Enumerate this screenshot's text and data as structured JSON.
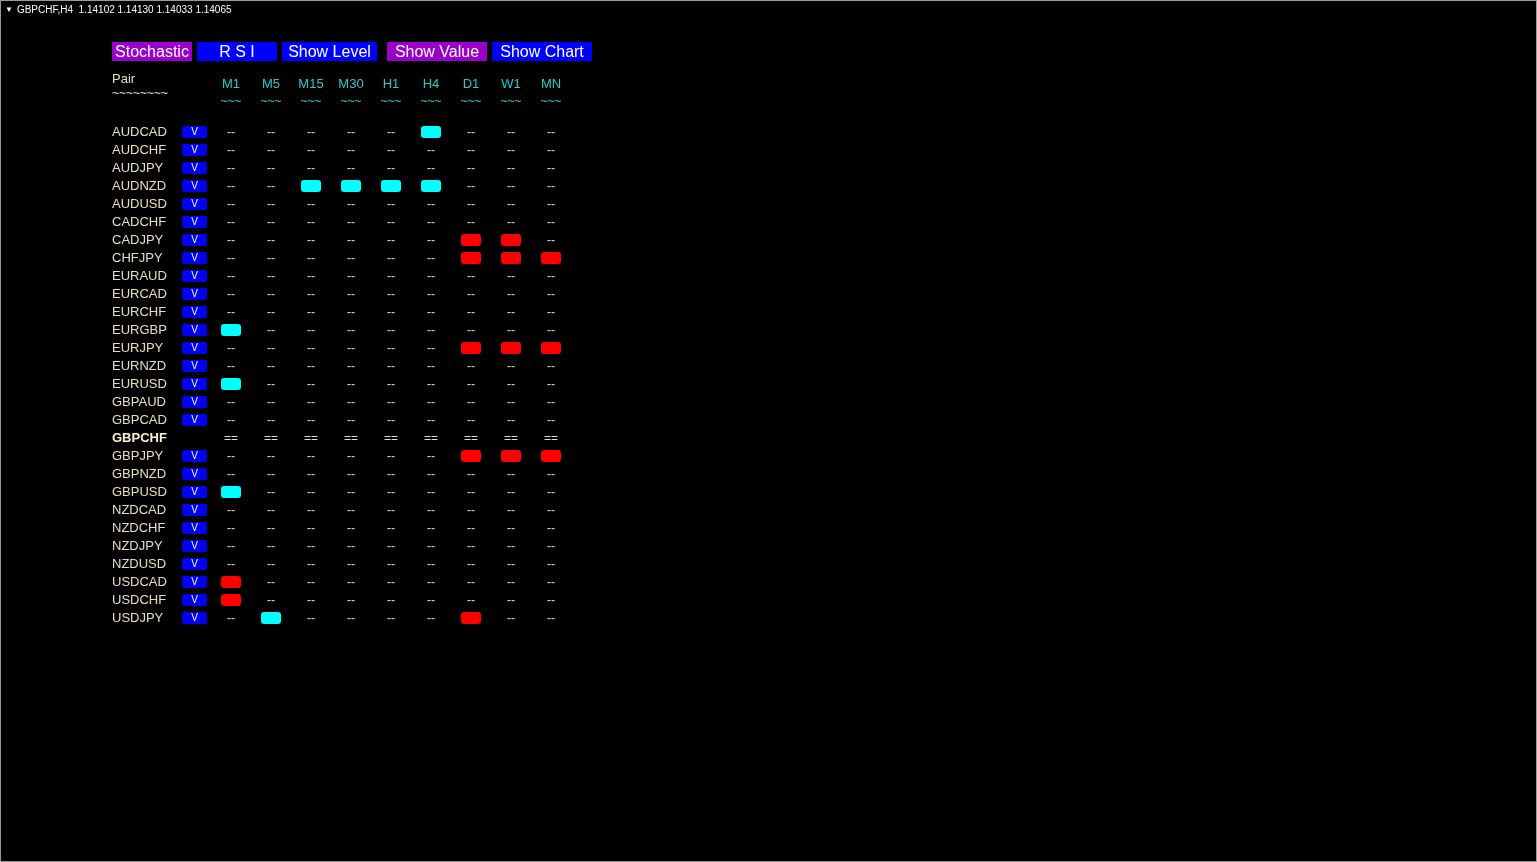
{
  "chart_title": {
    "arrow": "▼",
    "text": "GBPCHF,H4  1.14102 1.14130 1.14033 1.14065"
  },
  "buttons": [
    {
      "label": "Stochastic",
      "selected": true
    },
    {
      "label": "R S I",
      "selected": false
    },
    {
      "label": "Show Level",
      "selected": false
    },
    {
      "label": "Show Value",
      "selected": true
    },
    {
      "label": "Show Chart",
      "selected": false
    }
  ],
  "table": {
    "pair_header": {
      "label": "Pair",
      "underline": "~~~~~~~~"
    },
    "columns": [
      {
        "label": "M1",
        "underline": "~~~"
      },
      {
        "label": "M5",
        "underline": "~~~"
      },
      {
        "label": "M15",
        "underline": "~~~"
      },
      {
        "label": "M30",
        "underline": "~~~"
      },
      {
        "label": "H1",
        "underline": "~~~"
      },
      {
        "label": "H4",
        "underline": "~~~"
      },
      {
        "label": "D1",
        "underline": "~~~"
      },
      {
        "label": "W1",
        "underline": "~~~"
      },
      {
        "label": "MN",
        "underline": "~~~"
      }
    ],
    "rows": [
      {
        "pair": "AUDCAD",
        "current": false,
        "button": "V",
        "cells": [
          {
            "kind": "text",
            "text": "--"
          },
          {
            "kind": "text",
            "text": "--"
          },
          {
            "kind": "text",
            "text": "--"
          },
          {
            "kind": "text",
            "text": "--"
          },
          {
            "kind": "text",
            "text": "--"
          },
          {
            "kind": "signal",
            "color": "#00ffff"
          },
          {
            "kind": "text",
            "text": "--"
          },
          {
            "kind": "text",
            "text": "--"
          },
          {
            "kind": "text",
            "text": "--"
          }
        ]
      },
      {
        "pair": "AUDCHF",
        "current": false,
        "button": "V",
        "cells": [
          {
            "kind": "text",
            "text": "--"
          },
          {
            "kind": "text",
            "text": "--"
          },
          {
            "kind": "text",
            "text": "--"
          },
          {
            "kind": "text",
            "text": "--"
          },
          {
            "kind": "text",
            "text": "--"
          },
          {
            "kind": "text",
            "text": "--"
          },
          {
            "kind": "text",
            "text": "--"
          },
          {
            "kind": "text",
            "text": "--"
          },
          {
            "kind": "text",
            "text": "--"
          }
        ]
      },
      {
        "pair": "AUDJPY",
        "current": false,
        "button": "V",
        "cells": [
          {
            "kind": "text",
            "text": "--"
          },
          {
            "kind": "text",
            "text": "--"
          },
          {
            "kind": "text",
            "text": "--"
          },
          {
            "kind": "text",
            "text": "--"
          },
          {
            "kind": "text",
            "text": "--"
          },
          {
            "kind": "text",
            "text": "--"
          },
          {
            "kind": "text",
            "text": "--"
          },
          {
            "kind": "text",
            "text": "--"
          },
          {
            "kind": "text",
            "text": "--"
          }
        ]
      },
      {
        "pair": "AUDNZD",
        "current": false,
        "button": "V",
        "cells": [
          {
            "kind": "text",
            "text": "--"
          },
          {
            "kind": "text",
            "text": "--"
          },
          {
            "kind": "signal",
            "color": "#00ffff"
          },
          {
            "kind": "signal",
            "color": "#00ffff"
          },
          {
            "kind": "signal",
            "color": "#00ffff"
          },
          {
            "kind": "signal",
            "color": "#00ffff"
          },
          {
            "kind": "text",
            "text": "--"
          },
          {
            "kind": "text",
            "text": "--"
          },
          {
            "kind": "text",
            "text": "--"
          }
        ]
      },
      {
        "pair": "AUDUSD",
        "current": false,
        "button": "V",
        "cells": [
          {
            "kind": "text",
            "text": "--"
          },
          {
            "kind": "text",
            "text": "--"
          },
          {
            "kind": "text",
            "text": "--"
          },
          {
            "kind": "text",
            "text": "--"
          },
          {
            "kind": "text",
            "text": "--"
          },
          {
            "kind": "text",
            "text": "--"
          },
          {
            "kind": "text",
            "text": "--"
          },
          {
            "kind": "text",
            "text": "--"
          },
          {
            "kind": "text",
            "text": "--"
          }
        ]
      },
      {
        "pair": "CADCHF",
        "current": false,
        "button": "V",
        "cells": [
          {
            "kind": "text",
            "text": "--"
          },
          {
            "kind": "text",
            "text": "--"
          },
          {
            "kind": "text",
            "text": "--"
          },
          {
            "kind": "text",
            "text": "--"
          },
          {
            "kind": "text",
            "text": "--"
          },
          {
            "kind": "text",
            "text": "--"
          },
          {
            "kind": "text",
            "text": "--"
          },
          {
            "kind": "text",
            "text": "--"
          },
          {
            "kind": "text",
            "text": "--"
          }
        ]
      },
      {
        "pair": "CADJPY",
        "current": false,
        "button": "V",
        "cells": [
          {
            "kind": "text",
            "text": "--"
          },
          {
            "kind": "text",
            "text": "--"
          },
          {
            "kind": "text",
            "text": "--"
          },
          {
            "kind": "text",
            "text": "--"
          },
          {
            "kind": "text",
            "text": "--"
          },
          {
            "kind": "text",
            "text": "--"
          },
          {
            "kind": "signal",
            "color": "#ff0000"
          },
          {
            "kind": "signal",
            "color": "#ff0000"
          },
          {
            "kind": "text",
            "text": "--"
          }
        ]
      },
      {
        "pair": "CHFJPY",
        "current": false,
        "button": "V",
        "cells": [
          {
            "kind": "text",
            "text": "--"
          },
          {
            "kind": "text",
            "text": "--"
          },
          {
            "kind": "text",
            "text": "--"
          },
          {
            "kind": "text",
            "text": "--"
          },
          {
            "kind": "text",
            "text": "--"
          },
          {
            "kind": "text",
            "text": "--"
          },
          {
            "kind": "signal",
            "color": "#ff0000"
          },
          {
            "kind": "signal",
            "color": "#ff0000"
          },
          {
            "kind": "signal",
            "color": "#ff0000"
          }
        ]
      },
      {
        "pair": "EURAUD",
        "current": false,
        "button": "V",
        "cells": [
          {
            "kind": "text",
            "text": "--"
          },
          {
            "kind": "text",
            "text": "--"
          },
          {
            "kind": "text",
            "text": "--"
          },
          {
            "kind": "text",
            "text": "--"
          },
          {
            "kind": "text",
            "text": "--"
          },
          {
            "kind": "text",
            "text": "--"
          },
          {
            "kind": "text",
            "text": "--"
          },
          {
            "kind": "text",
            "text": "--"
          },
          {
            "kind": "text",
            "text": "--"
          }
        ]
      },
      {
        "pair": "EURCAD",
        "current": false,
        "button": "V",
        "cells": [
          {
            "kind": "text",
            "text": "--"
          },
          {
            "kind": "text",
            "text": "--"
          },
          {
            "kind": "text",
            "text": "--"
          },
          {
            "kind": "text",
            "text": "--"
          },
          {
            "kind": "text",
            "text": "--"
          },
          {
            "kind": "text",
            "text": "--"
          },
          {
            "kind": "text",
            "text": "--"
          },
          {
            "kind": "text",
            "text": "--"
          },
          {
            "kind": "text",
            "text": "--"
          }
        ]
      },
      {
        "pair": "EURCHF",
        "current": false,
        "button": "V",
        "cells": [
          {
            "kind": "text",
            "text": "--"
          },
          {
            "kind": "text",
            "text": "--"
          },
          {
            "kind": "text",
            "text": "--"
          },
          {
            "kind": "text",
            "text": "--"
          },
          {
            "kind": "text",
            "text": "--"
          },
          {
            "kind": "text",
            "text": "--"
          },
          {
            "kind": "text",
            "text": "--"
          },
          {
            "kind": "text",
            "text": "--"
          },
          {
            "kind": "text",
            "text": "--"
          }
        ]
      },
      {
        "pair": "EURGBP",
        "current": false,
        "button": "V",
        "cells": [
          {
            "kind": "signal",
            "color": "#00ffff"
          },
          {
            "kind": "text",
            "text": "--"
          },
          {
            "kind": "text",
            "text": "--"
          },
          {
            "kind": "text",
            "text": "--"
          },
          {
            "kind": "text",
            "text": "--"
          },
          {
            "kind": "text",
            "text": "--"
          },
          {
            "kind": "text",
            "text": "--"
          },
          {
            "kind": "text",
            "text": "--"
          },
          {
            "kind": "text",
            "text": "--"
          }
        ]
      },
      {
        "pair": "EURJPY",
        "current": false,
        "button": "V",
        "cells": [
          {
            "kind": "text",
            "text": "--"
          },
          {
            "kind": "text",
            "text": "--"
          },
          {
            "kind": "text",
            "text": "--"
          },
          {
            "kind": "text",
            "text": "--"
          },
          {
            "kind": "text",
            "text": "--"
          },
          {
            "kind": "text",
            "text": "--"
          },
          {
            "kind": "signal",
            "color": "#ff0000"
          },
          {
            "kind": "signal",
            "color": "#ff0000"
          },
          {
            "kind": "signal",
            "color": "#ff0000"
          }
        ]
      },
      {
        "pair": "EURNZD",
        "current": false,
        "button": "V",
        "cells": [
          {
            "kind": "text",
            "text": "--"
          },
          {
            "kind": "text",
            "text": "--"
          },
          {
            "kind": "text",
            "text": "--"
          },
          {
            "kind": "text",
            "text": "--"
          },
          {
            "kind": "text",
            "text": "--"
          },
          {
            "kind": "text",
            "text": "--"
          },
          {
            "kind": "text",
            "text": "--"
          },
          {
            "kind": "text",
            "text": "--"
          },
          {
            "kind": "text",
            "text": "--"
          }
        ]
      },
      {
        "pair": "EURUSD",
        "current": false,
        "button": "V",
        "cells": [
          {
            "kind": "signal",
            "color": "#00ffff"
          },
          {
            "kind": "text",
            "text": "--"
          },
          {
            "kind": "text",
            "text": "--"
          },
          {
            "kind": "text",
            "text": "--"
          },
          {
            "kind": "text",
            "text": "--"
          },
          {
            "kind": "text",
            "text": "--"
          },
          {
            "kind": "text",
            "text": "--"
          },
          {
            "kind": "text",
            "text": "--"
          },
          {
            "kind": "text",
            "text": "--"
          }
        ]
      },
      {
        "pair": "GBPAUD",
        "current": false,
        "button": "V",
        "cells": [
          {
            "kind": "text",
            "text": "--"
          },
          {
            "kind": "text",
            "text": "--"
          },
          {
            "kind": "text",
            "text": "--"
          },
          {
            "kind": "text",
            "text": "--"
          },
          {
            "kind": "text",
            "text": "--"
          },
          {
            "kind": "text",
            "text": "--"
          },
          {
            "kind": "text",
            "text": "--"
          },
          {
            "kind": "text",
            "text": "--"
          },
          {
            "kind": "text",
            "text": "--"
          }
        ]
      },
      {
        "pair": "GBPCAD",
        "current": false,
        "button": "V",
        "cells": [
          {
            "kind": "text",
            "text": "--"
          },
          {
            "kind": "text",
            "text": "--"
          },
          {
            "kind": "text",
            "text": "--"
          },
          {
            "kind": "text",
            "text": "--"
          },
          {
            "kind": "text",
            "text": "--"
          },
          {
            "kind": "text",
            "text": "--"
          },
          {
            "kind": "text",
            "text": "--"
          },
          {
            "kind": "text",
            "text": "--"
          },
          {
            "kind": "text",
            "text": "--"
          }
        ]
      },
      {
        "pair": "GBPCHF",
        "current": true,
        "cells": [
          {
            "kind": "text",
            "text": "=="
          },
          {
            "kind": "text",
            "text": "=="
          },
          {
            "kind": "text",
            "text": "=="
          },
          {
            "kind": "text",
            "text": "=="
          },
          {
            "kind": "text",
            "text": "=="
          },
          {
            "kind": "text",
            "text": "=="
          },
          {
            "kind": "text",
            "text": "=="
          },
          {
            "kind": "text",
            "text": "=="
          },
          {
            "kind": "text",
            "text": "=="
          }
        ]
      },
      {
        "pair": "GBPJPY",
        "current": false,
        "button": "V",
        "cells": [
          {
            "kind": "text",
            "text": "--"
          },
          {
            "kind": "text",
            "text": "--"
          },
          {
            "kind": "text",
            "text": "--"
          },
          {
            "kind": "text",
            "text": "--"
          },
          {
            "kind": "text",
            "text": "--"
          },
          {
            "kind": "text",
            "text": "--"
          },
          {
            "kind": "signal",
            "color": "#ff0000"
          },
          {
            "kind": "signal",
            "color": "#ff0000"
          },
          {
            "kind": "signal",
            "color": "#ff0000"
          }
        ]
      },
      {
        "pair": "GBPNZD",
        "current": false,
        "button": "V",
        "cells": [
          {
            "kind": "text",
            "text": "--"
          },
          {
            "kind": "text",
            "text": "--"
          },
          {
            "kind": "text",
            "text": "--"
          },
          {
            "kind": "text",
            "text": "--"
          },
          {
            "kind": "text",
            "text": "--"
          },
          {
            "kind": "text",
            "text": "--"
          },
          {
            "kind": "text",
            "text": "--"
          },
          {
            "kind": "text",
            "text": "--"
          },
          {
            "kind": "text",
            "text": "--"
          }
        ]
      },
      {
        "pair": "GBPUSD",
        "current": false,
        "button": "V",
        "cells": [
          {
            "kind": "signal",
            "color": "#00ffff"
          },
          {
            "kind": "text",
            "text": "--"
          },
          {
            "kind": "text",
            "text": "--"
          },
          {
            "kind": "text",
            "text": "--"
          },
          {
            "kind": "text",
            "text": "--"
          },
          {
            "kind": "text",
            "text": "--"
          },
          {
            "kind": "text",
            "text": "--"
          },
          {
            "kind": "text",
            "text": "--"
          },
          {
            "kind": "text",
            "text": "--"
          }
        ]
      },
      {
        "pair": "NZDCAD",
        "current": false,
        "button": "V",
        "cells": [
          {
            "kind": "text",
            "text": "--"
          },
          {
            "kind": "text",
            "text": "--"
          },
          {
            "kind": "text",
            "text": "--"
          },
          {
            "kind": "text",
            "text": "--"
          },
          {
            "kind": "text",
            "text": "--"
          },
          {
            "kind": "text",
            "text": "--"
          },
          {
            "kind": "text",
            "text": "--"
          },
          {
            "kind": "text",
            "text": "--"
          },
          {
            "kind": "text",
            "text": "--"
          }
        ]
      },
      {
        "pair": "NZDCHF",
        "current": false,
        "button": "V",
        "cells": [
          {
            "kind": "text",
            "text": "--"
          },
          {
            "kind": "text",
            "text": "--"
          },
          {
            "kind": "text",
            "text": "--"
          },
          {
            "kind": "text",
            "text": "--"
          },
          {
            "kind": "text",
            "text": "--"
          },
          {
            "kind": "text",
            "text": "--"
          },
          {
            "kind": "text",
            "text": "--"
          },
          {
            "kind": "text",
            "text": "--"
          },
          {
            "kind": "text",
            "text": "--"
          }
        ]
      },
      {
        "pair": "NZDJPY",
        "current": false,
        "button": "V",
        "cells": [
          {
            "kind": "text",
            "text": "--"
          },
          {
            "kind": "text",
            "text": "--"
          },
          {
            "kind": "text",
            "text": "--"
          },
          {
            "kind": "text",
            "text": "--"
          },
          {
            "kind": "text",
            "text": "--"
          },
          {
            "kind": "text",
            "text": "--"
          },
          {
            "kind": "text",
            "text": "--"
          },
          {
            "kind": "text",
            "text": "--"
          },
          {
            "kind": "text",
            "text": "--"
          }
        ]
      },
      {
        "pair": "NZDUSD",
        "current": false,
        "button": "V",
        "cells": [
          {
            "kind": "text",
            "text": "--"
          },
          {
            "kind": "text",
            "text": "--"
          },
          {
            "kind": "text",
            "text": "--"
          },
          {
            "kind": "text",
            "text": "--"
          },
          {
            "kind": "text",
            "text": "--"
          },
          {
            "kind": "text",
            "text": "--"
          },
          {
            "kind": "text",
            "text": "--"
          },
          {
            "kind": "text",
            "text": "--"
          },
          {
            "kind": "text",
            "text": "--"
          }
        ]
      },
      {
        "pair": "USDCAD",
        "current": false,
        "button": "V",
        "cells": [
          {
            "kind": "signal",
            "color": "#ff0000"
          },
          {
            "kind": "text",
            "text": "--"
          },
          {
            "kind": "text",
            "text": "--"
          },
          {
            "kind": "text",
            "text": "--"
          },
          {
            "kind": "text",
            "text": "--"
          },
          {
            "kind": "text",
            "text": "--"
          },
          {
            "kind": "text",
            "text": "--"
          },
          {
            "kind": "text",
            "text": "--"
          },
          {
            "kind": "text",
            "text": "--"
          }
        ]
      },
      {
        "pair": "USDCHF",
        "current": false,
        "button": "V",
        "cells": [
          {
            "kind": "signal",
            "color": "#ff0000"
          },
          {
            "kind": "text",
            "text": "--"
          },
          {
            "kind": "text",
            "text": "--"
          },
          {
            "kind": "text",
            "text": "--"
          },
          {
            "kind": "text",
            "text": "--"
          },
          {
            "kind": "text",
            "text": "--"
          },
          {
            "kind": "text",
            "text": "--"
          },
          {
            "kind": "text",
            "text": "--"
          },
          {
            "kind": "text",
            "text": "--"
          }
        ]
      },
      {
        "pair": "USDJPY",
        "current": false,
        "button": "V",
        "cells": [
          {
            "kind": "text",
            "text": "--"
          },
          {
            "kind": "signal",
            "color": "#00ffff"
          },
          {
            "kind": "text",
            "text": "--"
          },
          {
            "kind": "text",
            "text": "--"
          },
          {
            "kind": "text",
            "text": "--"
          },
          {
            "kind": "text",
            "text": "--"
          },
          {
            "kind": "signal",
            "color": "#ff0000"
          },
          {
            "kind": "text",
            "text": "--"
          },
          {
            "kind": "text",
            "text": "--"
          }
        ]
      }
    ]
  }
}
